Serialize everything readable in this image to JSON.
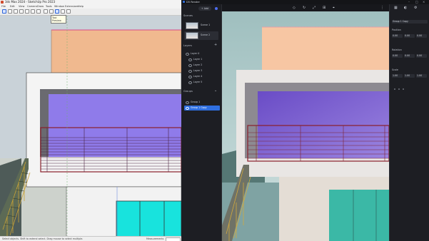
{
  "left_window": {
    "title": "3ds Max 2024 - SketchUp Pro 2023",
    "menu": [
      "File",
      "Edit",
      "View",
      "Camera",
      "Draw",
      "Tools",
      "Window",
      "Extensions",
      "Help"
    ],
    "tooltip_lines": [
      "Tool",
      "Preview"
    ],
    "status": {
      "info": "Select objects. Shift to extend select. Drag mouse to select multiple.",
      "measurements_label": "Measurements"
    }
  },
  "right_app": {
    "title": "D5 Render",
    "scenes": {
      "header": "Scenes",
      "add_label": "+ Add",
      "items": [
        {
          "label": "Scene 1"
        },
        {
          "label": "Scene 2"
        }
      ]
    },
    "layers": {
      "header": "Layers",
      "items": [
        {
          "label": "Layer 0"
        },
        {
          "label": "Layer 1"
        },
        {
          "label": "Layer 2"
        },
        {
          "label": "Layer 3"
        },
        {
          "label": "Layer 4"
        },
        {
          "label": "Layer 5"
        }
      ]
    },
    "groups": {
      "header": "Groups",
      "items": [
        {
          "label": "Group 1"
        },
        {
          "label": "Group 1 Copy"
        }
      ]
    },
    "properties": {
      "name_value": "Group 1 Copy",
      "labels": [
        "Position",
        "Rotation",
        "Scale"
      ],
      "values": [
        "0.00",
        "0.00",
        "0.00",
        "0.00",
        "0.00",
        "0.00",
        "1.00",
        "1.00",
        "1.00"
      ]
    }
  },
  "colors": {
    "accent": "#2f6fe0",
    "upper_block": "#f0b98f",
    "upper_block_render": "#f7c6a3",
    "balcony_inner": "#8f7bea",
    "balcony_inner_render": "#7a5bd0",
    "railing": "#8a1f2b",
    "glass": "#18e3dd",
    "glass_render": "#3bb8a6",
    "wall": "#f2f2f2"
  }
}
